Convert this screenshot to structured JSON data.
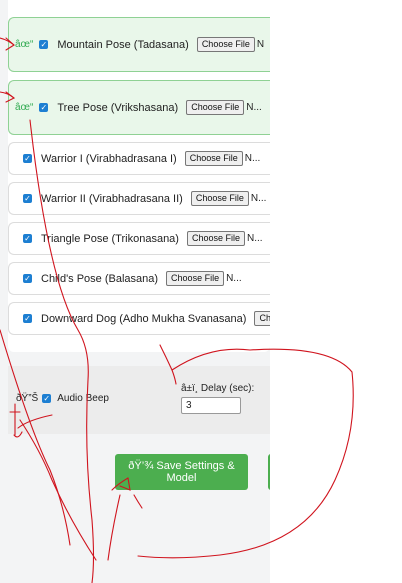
{
  "poses": [
    {
      "label": "Mountain Pose (Tadasana)",
      "file_button": "Choose File",
      "file_status": "N",
      "status_mark": "âœ“",
      "checked": true,
      "done": true
    },
    {
      "label": "Tree Pose (Vrikshasana)",
      "file_button": "Choose File",
      "file_status": "N...",
      "status_mark": "âœ“",
      "checked": true,
      "done": true
    },
    {
      "label": "Warrior I (Virabhadrasana I)",
      "file_button": "Choose File",
      "file_status": "N...",
      "checked": true,
      "done": false
    },
    {
      "label": "Warrior II (Virabhadrasana II)",
      "file_button": "Choose File",
      "file_status": "N...",
      "checked": true,
      "done": false
    },
    {
      "label": "Triangle Pose (Trikonasana)",
      "file_button": "Choose File",
      "file_status": "N...",
      "checked": true,
      "done": false
    },
    {
      "label": "Child's Pose (Balasana)",
      "file_button": "Choose File",
      "file_status": "N...",
      "checked": true,
      "done": false
    },
    {
      "label": "Downward Dog (Adho Mukha Svanasana)",
      "file_button": "Cho",
      "file_status": "",
      "checked": true,
      "done": false
    }
  ],
  "settings": {
    "beep_icon": "ðŸ”Š",
    "beep_label": "Audio Beep",
    "beep_checked": true,
    "delay_label": "â±ï¸ Delay (sec):",
    "delay_value": "3"
  },
  "actions": {
    "save_label": "ðŸ’¾ Save Settings & Model"
  },
  "colors": {
    "accent_green": "#4cae4f",
    "checkbox_blue": "#1d7fd2",
    "annotation_red": "#d0141e"
  }
}
